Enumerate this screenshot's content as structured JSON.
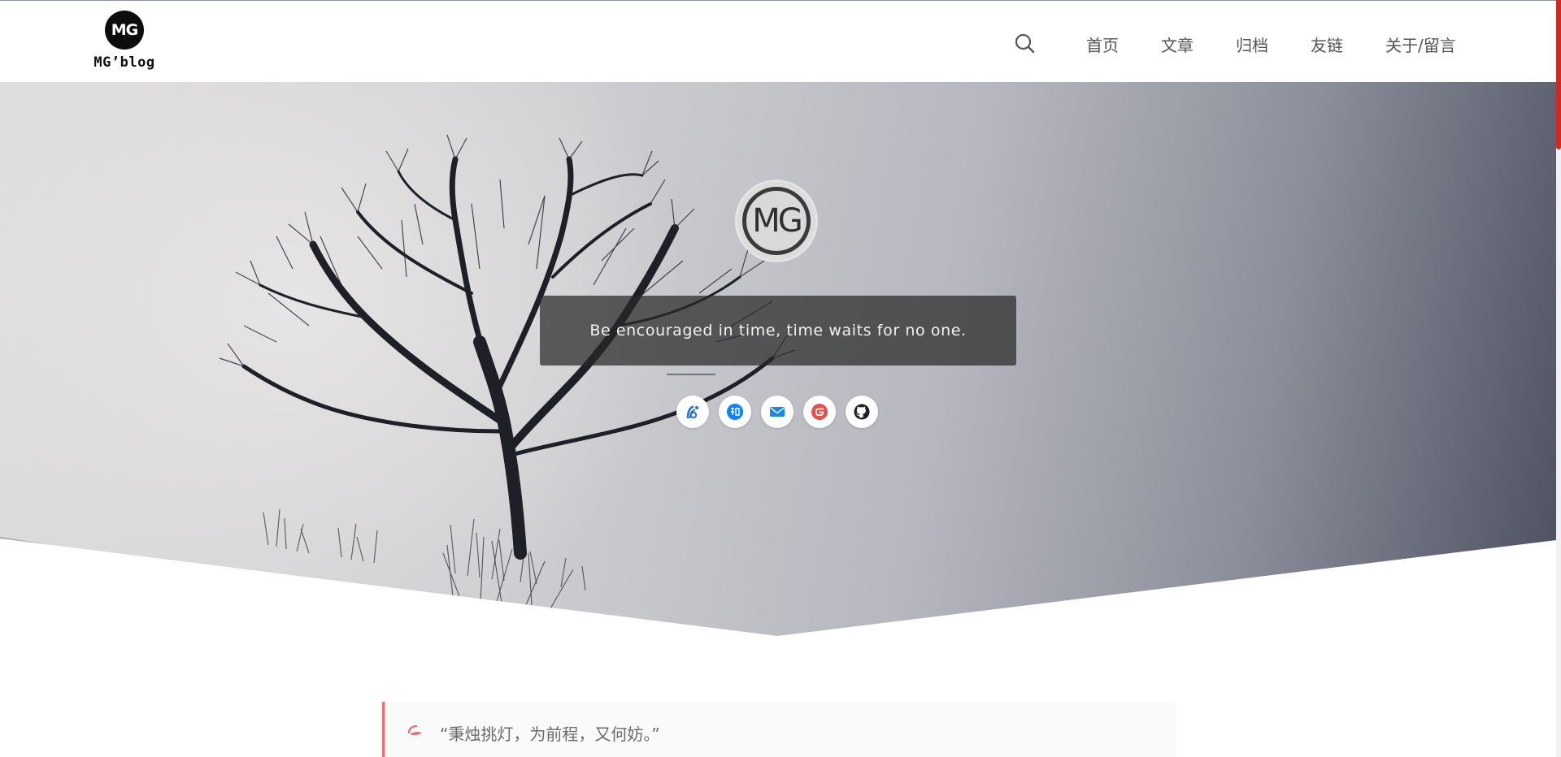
{
  "site": {
    "brand_logo_text": "MG",
    "brand_name": "MG’blog"
  },
  "nav": {
    "items": [
      {
        "label": "首页"
      },
      {
        "label": "文章"
      },
      {
        "label": "归档"
      },
      {
        "label": "友链"
      },
      {
        "label": "关于/留言"
      }
    ]
  },
  "hero": {
    "avatar_text": "MG",
    "motto": "Be encouraged in time, time waits for no one.",
    "social_icons": [
      "blog-icon",
      "zhihu-icon",
      "email-icon",
      "gitee-icon",
      "github-icon"
    ]
  },
  "quote": {
    "text": "“秉烛挑灯，为前程，又何妨。”"
  },
  "colors": {
    "accent_red": "#d9261c",
    "quote_border": "#f06b6b",
    "motto_bg": "#282828",
    "zhihu_blue": "#0a84ff",
    "gitee_red": "#e3524f"
  }
}
